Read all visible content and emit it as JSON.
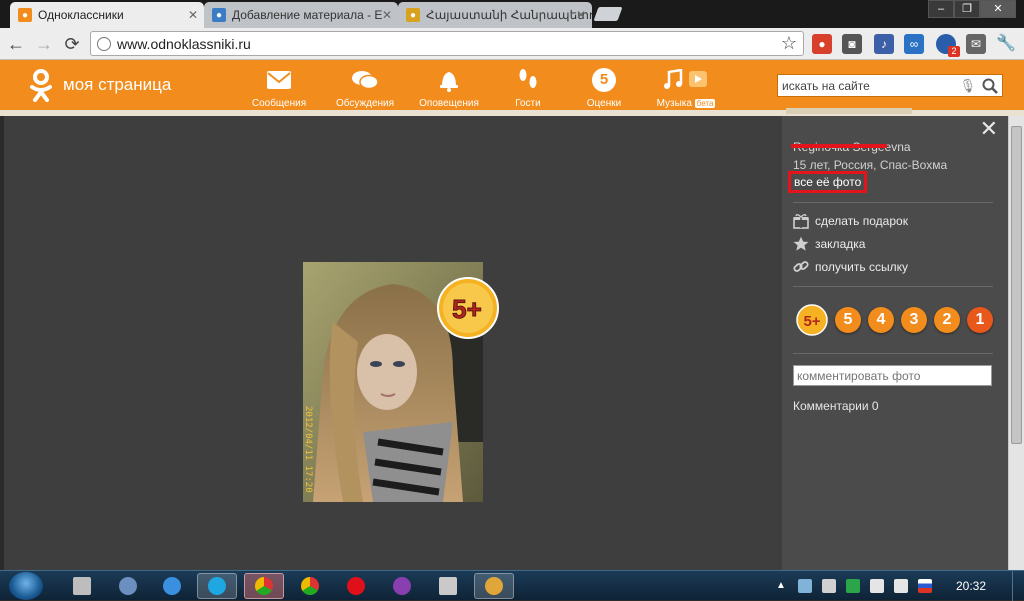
{
  "browser": {
    "tabs": [
      {
        "title": "Одноклассники",
        "favicon": "ok-favicon",
        "active": true
      },
      {
        "title": "Добавление материала - Е",
        "favicon": "globe-favicon",
        "active": false
      },
      {
        "title": "Հայաստանի Հանրապետու",
        "favicon": "emblem-favicon",
        "active": false
      }
    ],
    "address": "www.odnoklassniki.ru",
    "extension_badge": "2"
  },
  "site": {
    "title": "моя страница",
    "brand_color": "#f28c1c",
    "nav": [
      {
        "label": "Сообщения",
        "icon": "envelope-icon"
      },
      {
        "label": "Обсуждения",
        "icon": "speech-bubbles-icon"
      },
      {
        "label": "Оповещения",
        "icon": "bell-icon"
      },
      {
        "label": "Гости",
        "icon": "footprints-icon"
      },
      {
        "label": "Оценки",
        "icon": "rating-five-icon",
        "digit": "5"
      },
      {
        "label": "Музыка",
        "icon": "music-note-icon",
        "badge": "бета"
      }
    ],
    "search_placeholder": "искать на сайте"
  },
  "viewer": {
    "photo_badge": "5+",
    "photo_timestamp": "2012/04/11 17:20",
    "owner_name": "Reginочка Sergeevna",
    "owner_info": "15 лет, Россия, Спас-Вохма",
    "all_photos_link": "все её фото",
    "actions": [
      {
        "label": "сделать подарок",
        "icon": "gift-icon"
      },
      {
        "label": "закладка",
        "icon": "star-icon"
      },
      {
        "label": "получить ссылку",
        "icon": "link-icon"
      }
    ],
    "ratings": [
      "5+",
      "5",
      "4",
      "3",
      "2",
      "1"
    ],
    "comment_placeholder": "комментировать фото",
    "comments_label": "Комментарии 0"
  },
  "taskbar": {
    "clock": "20:32"
  }
}
